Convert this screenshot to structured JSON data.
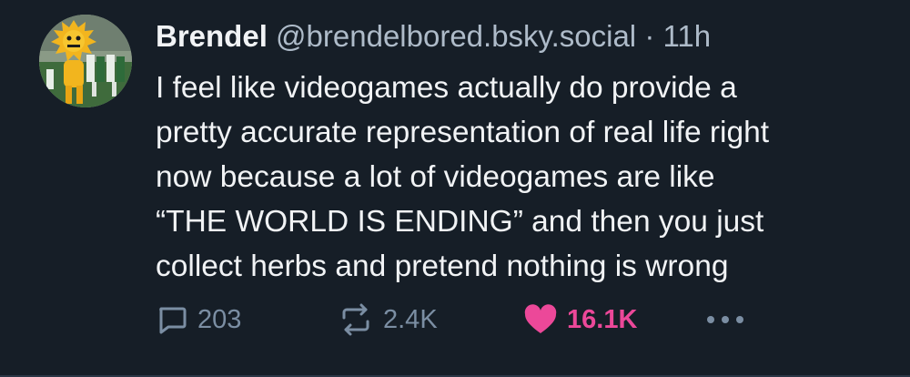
{
  "post": {
    "author_name": "Brendel",
    "handle": "@brendelbored.bsky.social",
    "separator": "·",
    "time": "11h",
    "text_lines": [
      "I feel like videogames actually do provide a",
      "pretty accurate representation of real life right",
      "now because a lot of videogames are like",
      "“THE WORLD IS ENDING” and then you just",
      "collect herbs and pretend nothing is wrong"
    ]
  },
  "actions": {
    "replies": "203",
    "reposts": "2.4K",
    "likes": "16.1K",
    "liked": true
  },
  "icons": {
    "reply": "reply-bubble-icon",
    "repost": "repost-arrows-icon",
    "like": "heart-filled-icon",
    "more": "more-dots-icon"
  },
  "colors": {
    "background": "#161e27",
    "text": "#f1f3f5",
    "muted": "#aebbc9",
    "action": "#7b8ea3",
    "like": "#ec4899"
  }
}
